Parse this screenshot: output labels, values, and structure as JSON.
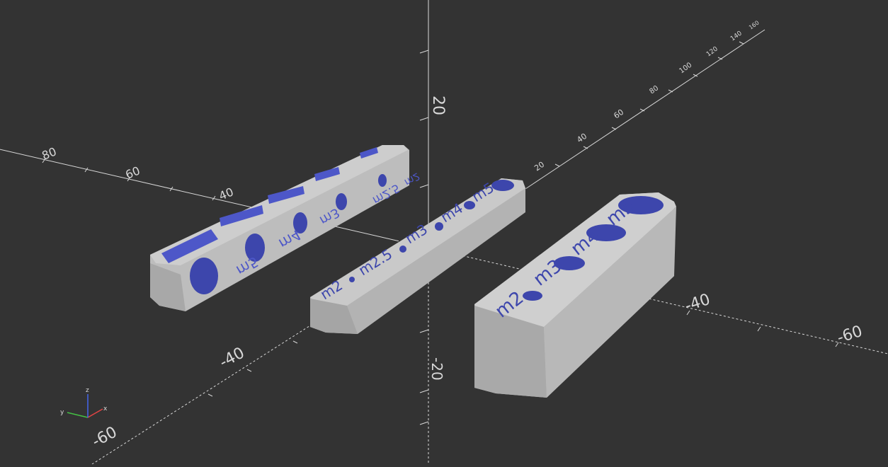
{
  "viewport": {
    "background": "#333333",
    "axis_color": "#d8d8d8",
    "axis_labels": {
      "x_pos_40": "40",
      "x_pos_60": "60",
      "x_pos_80": "80",
      "x_neg_40": "-40",
      "x_neg_60": "-60",
      "y_neg_40": "-40",
      "y_neg_60": "-60",
      "y_20": "20",
      "y_40": "40",
      "y_60": "60",
      "y_80": "80",
      "y_100": "100",
      "y_120": "120",
      "y_140": "140",
      "y_160": "160",
      "z_20": "20",
      "z_neg_20": "-20"
    },
    "gizmo": {
      "x": "x",
      "y": "y",
      "z": "z"
    }
  },
  "models": {
    "face_color": "#c8c8c8",
    "side_color": "#a9a9a9",
    "hole_color": "#4d57c8",
    "bar_left_labels": [
      "m5",
      "m4",
      "m3",
      "m2.5",
      "m2"
    ],
    "bar_mid_labels": [
      "m2",
      "m2.5",
      "m3",
      "m4",
      "m5"
    ],
    "bar_right_labels": [
      "m2",
      "m3",
      "m4",
      "m5"
    ]
  }
}
